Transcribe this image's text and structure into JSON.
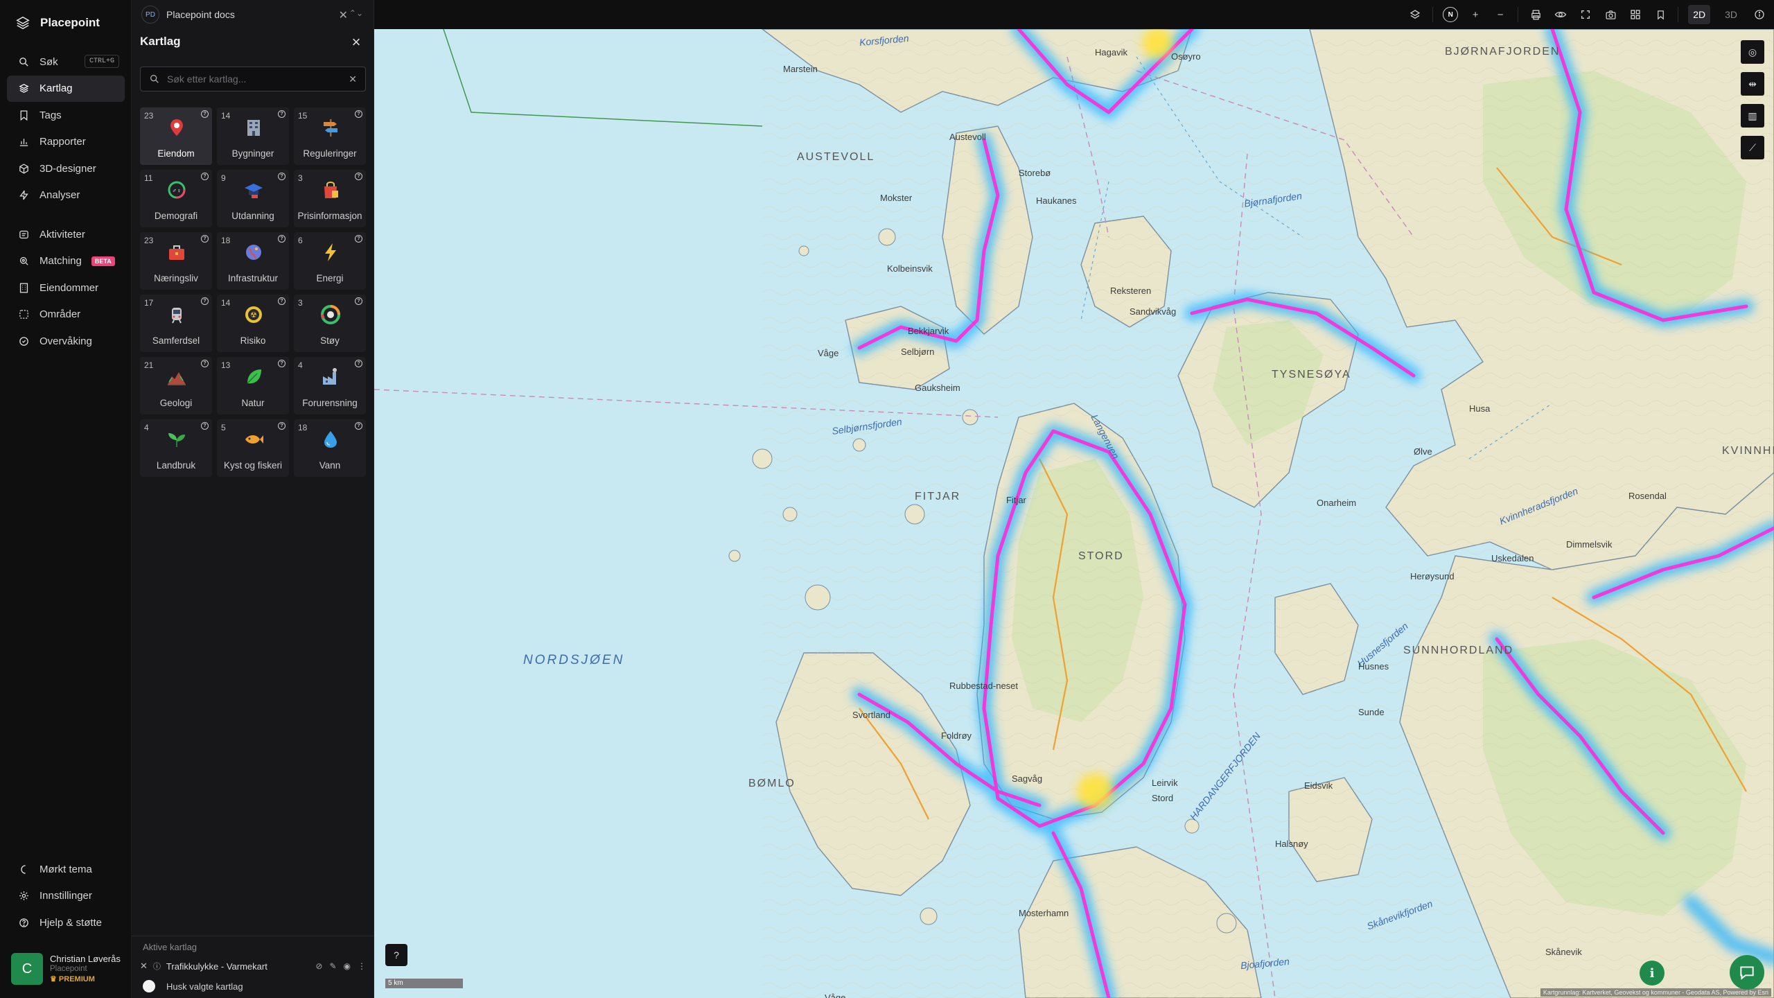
{
  "app": {
    "name": "Placepoint"
  },
  "nav": {
    "items": [
      {
        "label": "Søk",
        "shortcut": "CTRL+G",
        "icon": "search-icon"
      },
      {
        "label": "Kartlag",
        "icon": "layers-icon",
        "active": true
      },
      {
        "label": "Tags",
        "icon": "bookmark-icon"
      },
      {
        "label": "Rapporter",
        "icon": "chart-icon"
      },
      {
        "label": "3D-designer",
        "icon": "cube-icon"
      },
      {
        "label": "Analyser",
        "icon": "lightning-icon"
      },
      {
        "label": "Aktiviteter",
        "icon": "stack-icon"
      },
      {
        "label": "Matching",
        "badge": "BETA",
        "icon": "target-icon"
      },
      {
        "label": "Eiendommer",
        "icon": "building-icon"
      },
      {
        "label": "Områder",
        "icon": "area-icon"
      },
      {
        "label": "Overvåking",
        "icon": "monitor-icon"
      }
    ],
    "bottom": [
      {
        "label": "Mørkt tema",
        "icon": "moon-icon"
      },
      {
        "label": "Innstillinger",
        "icon": "gear-icon"
      },
      {
        "label": "Hjelp & støtte",
        "icon": "help-icon"
      }
    ],
    "user": {
      "initial": "C",
      "name": "Christian Løverås",
      "org": "Placepoint",
      "plan": "PREMIUM"
    }
  },
  "document": {
    "badge": "PD",
    "title": "Placepoint docs"
  },
  "panel": {
    "title": "Kartlag",
    "search_placeholder": "Søk etter kartlag...",
    "tiles": [
      {
        "count": "23",
        "label": "Eiendom",
        "icon": "pin-icon",
        "color": "#e03a3a",
        "selected": true
      },
      {
        "count": "14",
        "label": "Bygninger",
        "icon": "building-icon",
        "color": "#9aa5b5"
      },
      {
        "count": "15",
        "label": "Reguleringer",
        "icon": "signpost-icon",
        "color": "#d9883a"
      },
      {
        "count": "11",
        "label": "Demografi",
        "icon": "demography-icon",
        "color": "#3bbf6a"
      },
      {
        "count": "9",
        "label": "Utdanning",
        "icon": "graduation-icon",
        "color": "#3a6fd9"
      },
      {
        "count": "3",
        "label": "Prisinformasjon",
        "icon": "shopping-bag-icon",
        "color": "#e0463a"
      },
      {
        "count": "23",
        "label": "Næringsliv",
        "icon": "briefcase-icon",
        "color": "#e0463a"
      },
      {
        "count": "18",
        "label": "Infrastruktur",
        "icon": "globe-icon",
        "color": "#6a7bd9"
      },
      {
        "count": "6",
        "label": "Energi",
        "icon": "bolt-icon",
        "color": "#f2c230"
      },
      {
        "count": "17",
        "label": "Samferdsel",
        "icon": "train-icon",
        "color": "#c9c9c9"
      },
      {
        "count": "14",
        "label": "Risiko",
        "icon": "hazard-icon",
        "color": "#e6c23a"
      },
      {
        "count": "3",
        "label": "Støy",
        "icon": "gauge-icon",
        "color": "#f09a3a"
      },
      {
        "count": "21",
        "label": "Geologi",
        "icon": "terrain-icon",
        "color": "#b04a3a"
      },
      {
        "count": "13",
        "label": "Natur",
        "icon": "leaf-icon",
        "color": "#3bbf4a"
      },
      {
        "count": "4",
        "label": "Forurensning",
        "icon": "factory-icon",
        "color": "#8fb0d9"
      },
      {
        "count": "4",
        "label": "Landbruk",
        "icon": "sprout-icon",
        "color": "#4ac25a"
      },
      {
        "count": "5",
        "label": "Kyst og fiskeri",
        "icon": "fish-icon",
        "color": "#f0a030"
      },
      {
        "count": "18",
        "label": "Vann",
        "icon": "water-drop-icon",
        "color": "#3aa0e6"
      }
    ],
    "active_title": "Aktive kartlag",
    "active_layers": [
      {
        "label": "Trafikkulykke - Varmekart"
      }
    ],
    "remember_label": "Husk valgte kartlag"
  },
  "topbar": {
    "north": "N",
    "modes": [
      {
        "label": "2D",
        "active": true
      },
      {
        "label": "3D",
        "active": false
      }
    ]
  },
  "map": {
    "labels": {
      "ocean": "NORDSJØEN",
      "islands": [
        "AUSTEVOLL",
        "STORD",
        "TYSNESØYA",
        "SUNNHORDLAND",
        "BØMLO",
        "FITJAR",
        "BJØRNAFJORDEN",
        "KVINNHERAD"
      ],
      "fjords": [
        "Selbjørnsfjorden",
        "Bjørnafjorden",
        "Korsfjorden",
        "Kvinnheradsfjorden",
        "Langenuen",
        "HARDANGERFJORDEN",
        "Husnesfjorden",
        "Bjoafjorden",
        "Skånevikfjorden"
      ],
      "places": [
        "Osøyro",
        "Hagavik",
        "Marstein",
        "Austevoll",
        "Storebø",
        "Haukanes",
        "Mokster",
        "Kolbeinsvik",
        "Bekkjarvik",
        "Selbjørn",
        "Våge",
        "Gauksheim",
        "Fitjar",
        "Leirvik",
        "Stord",
        "Sagvåg",
        "Rubbestad-neset",
        "Svortland",
        "Foldrøy",
        "Mosterhamn",
        "Rosendal",
        "Uskedalen",
        "Sunde",
        "Husnes",
        "Herøysund",
        "Dimmelsvik",
        "Halsnøy",
        "Skånevik",
        "Eidsvik",
        "Ølve",
        "Husa",
        "Våge",
        "Onarheim",
        "Reksteren",
        "Sandvikvåg"
      ]
    },
    "scale": "5 km",
    "attribution": "Kartgrunnlag: Kartverket, Geovekst og kommuner - Geodata AS, Powered by Esri",
    "colors": {
      "sea": "#c9e9f2",
      "land": "#e8e4c8",
      "forest": "#cfe0b0",
      "heat": "#ff2bd6",
      "heat_halo": "#2db6ff",
      "road": "#f0a030"
    }
  }
}
